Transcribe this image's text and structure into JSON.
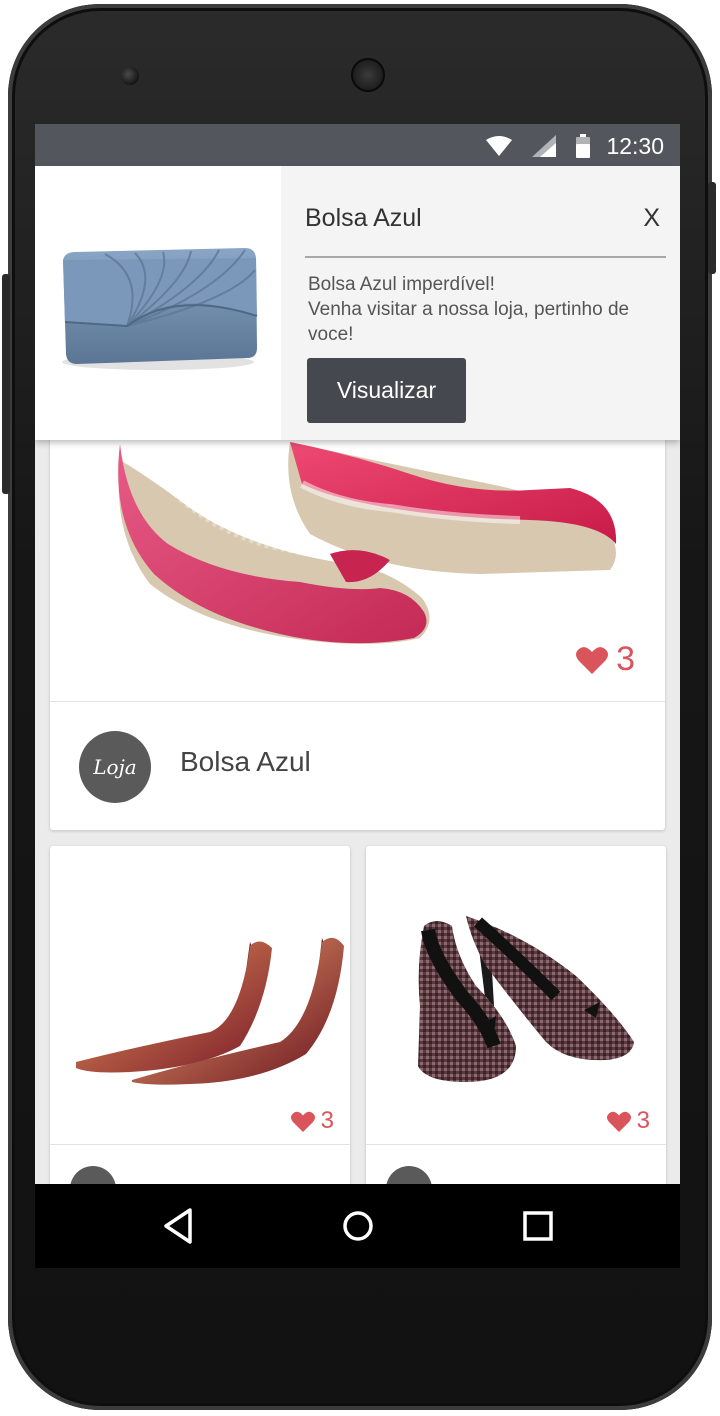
{
  "status_bar": {
    "time": "12:30",
    "icons": [
      "wifi-icon",
      "signal-icon",
      "battery-icon"
    ]
  },
  "notification": {
    "title": "Bolsa Azul",
    "close_label": "X",
    "message_line1": "Bolsa Azul imperdível!",
    "message_line2": "Venha visitar a nossa loja, pertinho de",
    "message_line3": "voce!",
    "button_label": "Visualizar",
    "image": "blue-clutch-bag"
  },
  "feed": {
    "main_card": {
      "image": "pink-wedge-shoes",
      "likes": "3",
      "store_avatar_text": "Loja",
      "store_name": "Bolsa Azul"
    },
    "small_cards": [
      {
        "image": "burgundy-high-heels",
        "likes": "3"
      },
      {
        "image": "tweed-high-heels",
        "likes": "3"
      }
    ]
  },
  "nav_bar": {
    "buttons": [
      "back-icon",
      "home-icon",
      "recents-icon"
    ]
  },
  "colors": {
    "accent": "#d9545b",
    "status_bar": "#53575d",
    "button": "#45484f"
  }
}
